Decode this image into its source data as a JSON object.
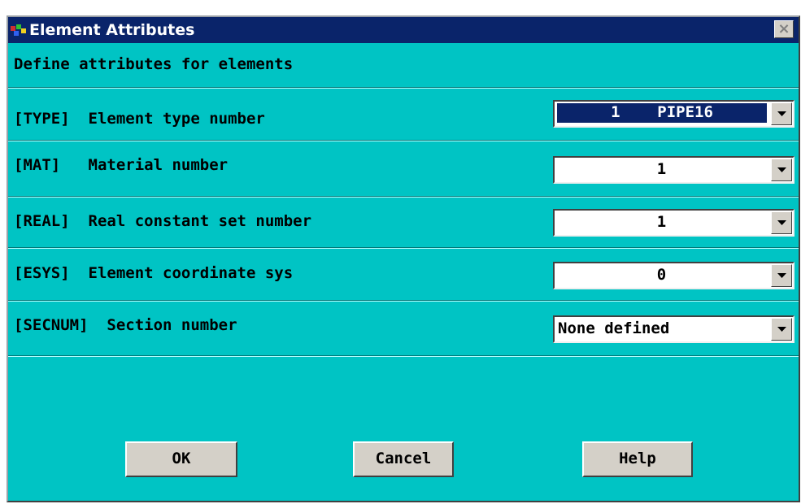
{
  "window": {
    "title": "Element Attributes",
    "close_label": "×"
  },
  "header": {
    "text": "Define attributes for elements"
  },
  "fields": [
    {
      "label": "[TYPE]  Element type number",
      "value": "1    PIPE16",
      "selected": true
    },
    {
      "label": "[MAT]   Material number",
      "value": "1",
      "selected": false
    },
    {
      "label": "[REAL]  Real constant set number",
      "value": "1",
      "selected": false
    },
    {
      "label": "[ESYS]  Element coordinate sys",
      "value": "0",
      "selected": false
    },
    {
      "label": "[SECNUM]  Section number",
      "value": "None defined",
      "selected": false
    }
  ],
  "buttons": {
    "ok": "OK",
    "cancel": "Cancel",
    "help": "Help"
  },
  "colors": {
    "background": "#00c4c4",
    "title_bar": "#0a246a",
    "selection": "#0a246a",
    "button_face": "#d4d0c8"
  }
}
